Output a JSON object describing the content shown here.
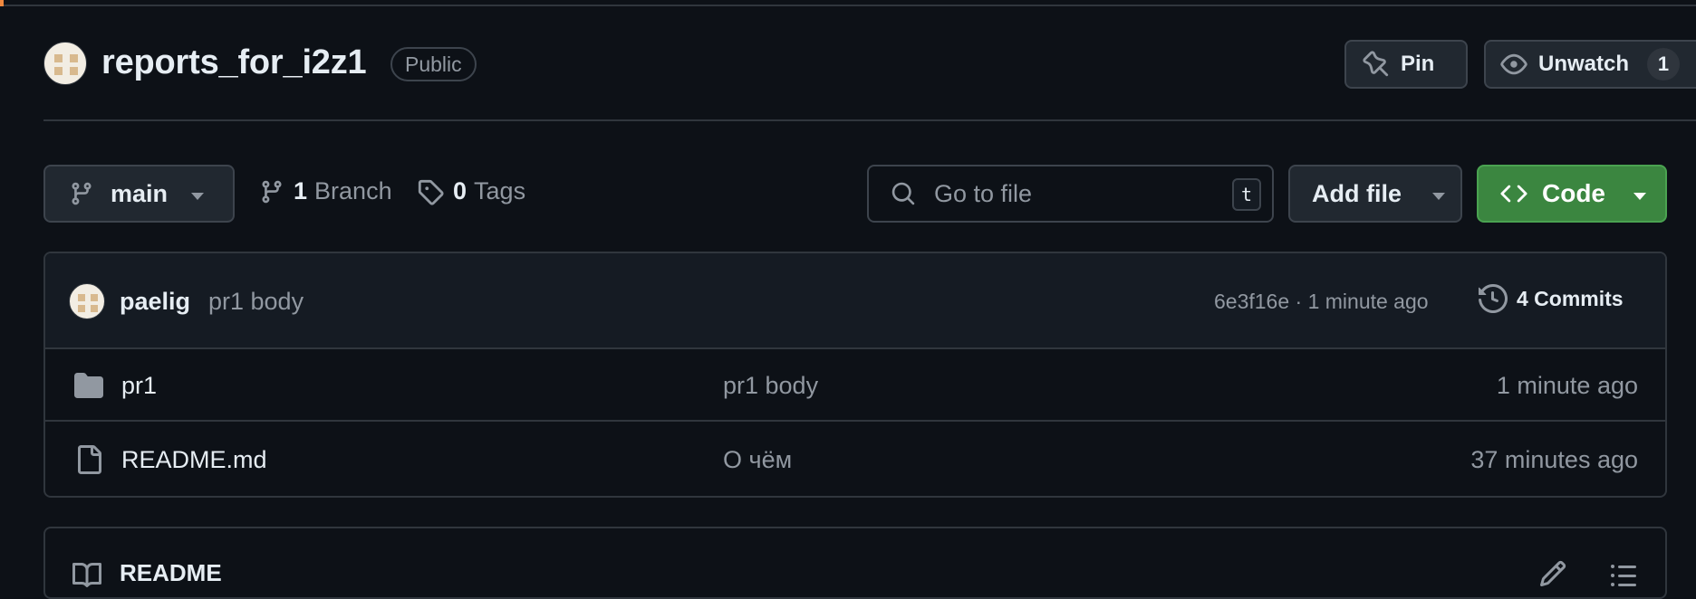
{
  "repo": {
    "name": "reports_for_i2z1",
    "visibility": "Public",
    "pin_label": "Pin",
    "watch_label": "Unwatch",
    "watch_count": "1"
  },
  "toolbar": {
    "branch": "main",
    "branch_count": "1",
    "branch_label": "Branch",
    "tag_count": "0",
    "tag_label": "Tags",
    "goto_placeholder": "Go to file",
    "goto_shortcut": "t",
    "add_file_label": "Add file",
    "code_label": "Code"
  },
  "latest_commit": {
    "author": "paelig",
    "message": "pr1 body",
    "meta": "6e3f16e · 1 minute ago",
    "commits_label": "4 Commits"
  },
  "files": [
    {
      "name": "pr1",
      "type": "folder",
      "message": "pr1 body",
      "age": "1 minute ago"
    },
    {
      "name": "README.md",
      "type": "file",
      "message": "О чём",
      "age": "37 minutes ago"
    }
  ],
  "readme": {
    "title": "README"
  },
  "colors": {
    "bg": "#0d1117",
    "border": "#30363d",
    "code_green": "#3b8640",
    "muted": "#9198a1"
  },
  "icons": [
    "pin-icon",
    "eye-icon",
    "branch-icon",
    "tag-icon",
    "search-icon",
    "code-icon",
    "history-icon",
    "folder-icon",
    "file-icon",
    "book-icon",
    "pencil-icon",
    "list-icon"
  ]
}
